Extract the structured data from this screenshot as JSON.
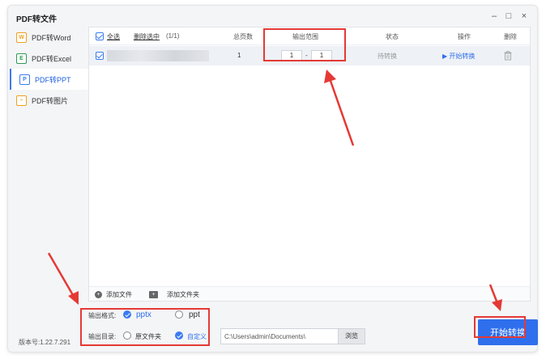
{
  "app": {
    "title": "PDF转文件",
    "version": "版本号:1.22.7.291"
  },
  "window_controls": {
    "minimize": "–",
    "maximize": "□",
    "close": "×"
  },
  "sidebar": {
    "items": [
      {
        "label": "PDF转Word",
        "icon": "W",
        "color": "#f0a020"
      },
      {
        "label": "PDF转Excel",
        "icon": "E",
        "color": "#2c9a55"
      },
      {
        "label": "PDF转PPT",
        "icon": "P",
        "color": "#3b7bf0"
      },
      {
        "label": "PDF转图片",
        "icon": "~",
        "color": "#f0a020"
      }
    ],
    "active_index": 2
  },
  "table": {
    "header": {
      "select_all": "全选",
      "delete_selected": "删除选中",
      "count": "(1/1)",
      "pages": "总页数",
      "output_range": "输出范围",
      "status": "状态",
      "action": "操作",
      "delete": "删除"
    },
    "rows": [
      {
        "pages": "1",
        "range_from": "1",
        "range_sep": "-",
        "range_to": "1",
        "status": "待转换",
        "action": "▶ 开始转换"
      }
    ]
  },
  "bottom_bar": {
    "add_file": "添加文件",
    "add_folder": "添加文件夹"
  },
  "options": {
    "format_label": "输出格式:",
    "format_pptx": "pptx",
    "format_ppt": "ppt",
    "selected_format": "pptx",
    "dir_label": "输出目录:",
    "dir_original": "原文件夹",
    "dir_custom": "自定义",
    "selected_dir": "自定义",
    "path": "C:\\Users\\admin\\Documents\\",
    "browse": "浏览"
  },
  "start_button": "开始转换",
  "colors": {
    "accent": "#2f6fed",
    "annotation": "#e53935"
  }
}
